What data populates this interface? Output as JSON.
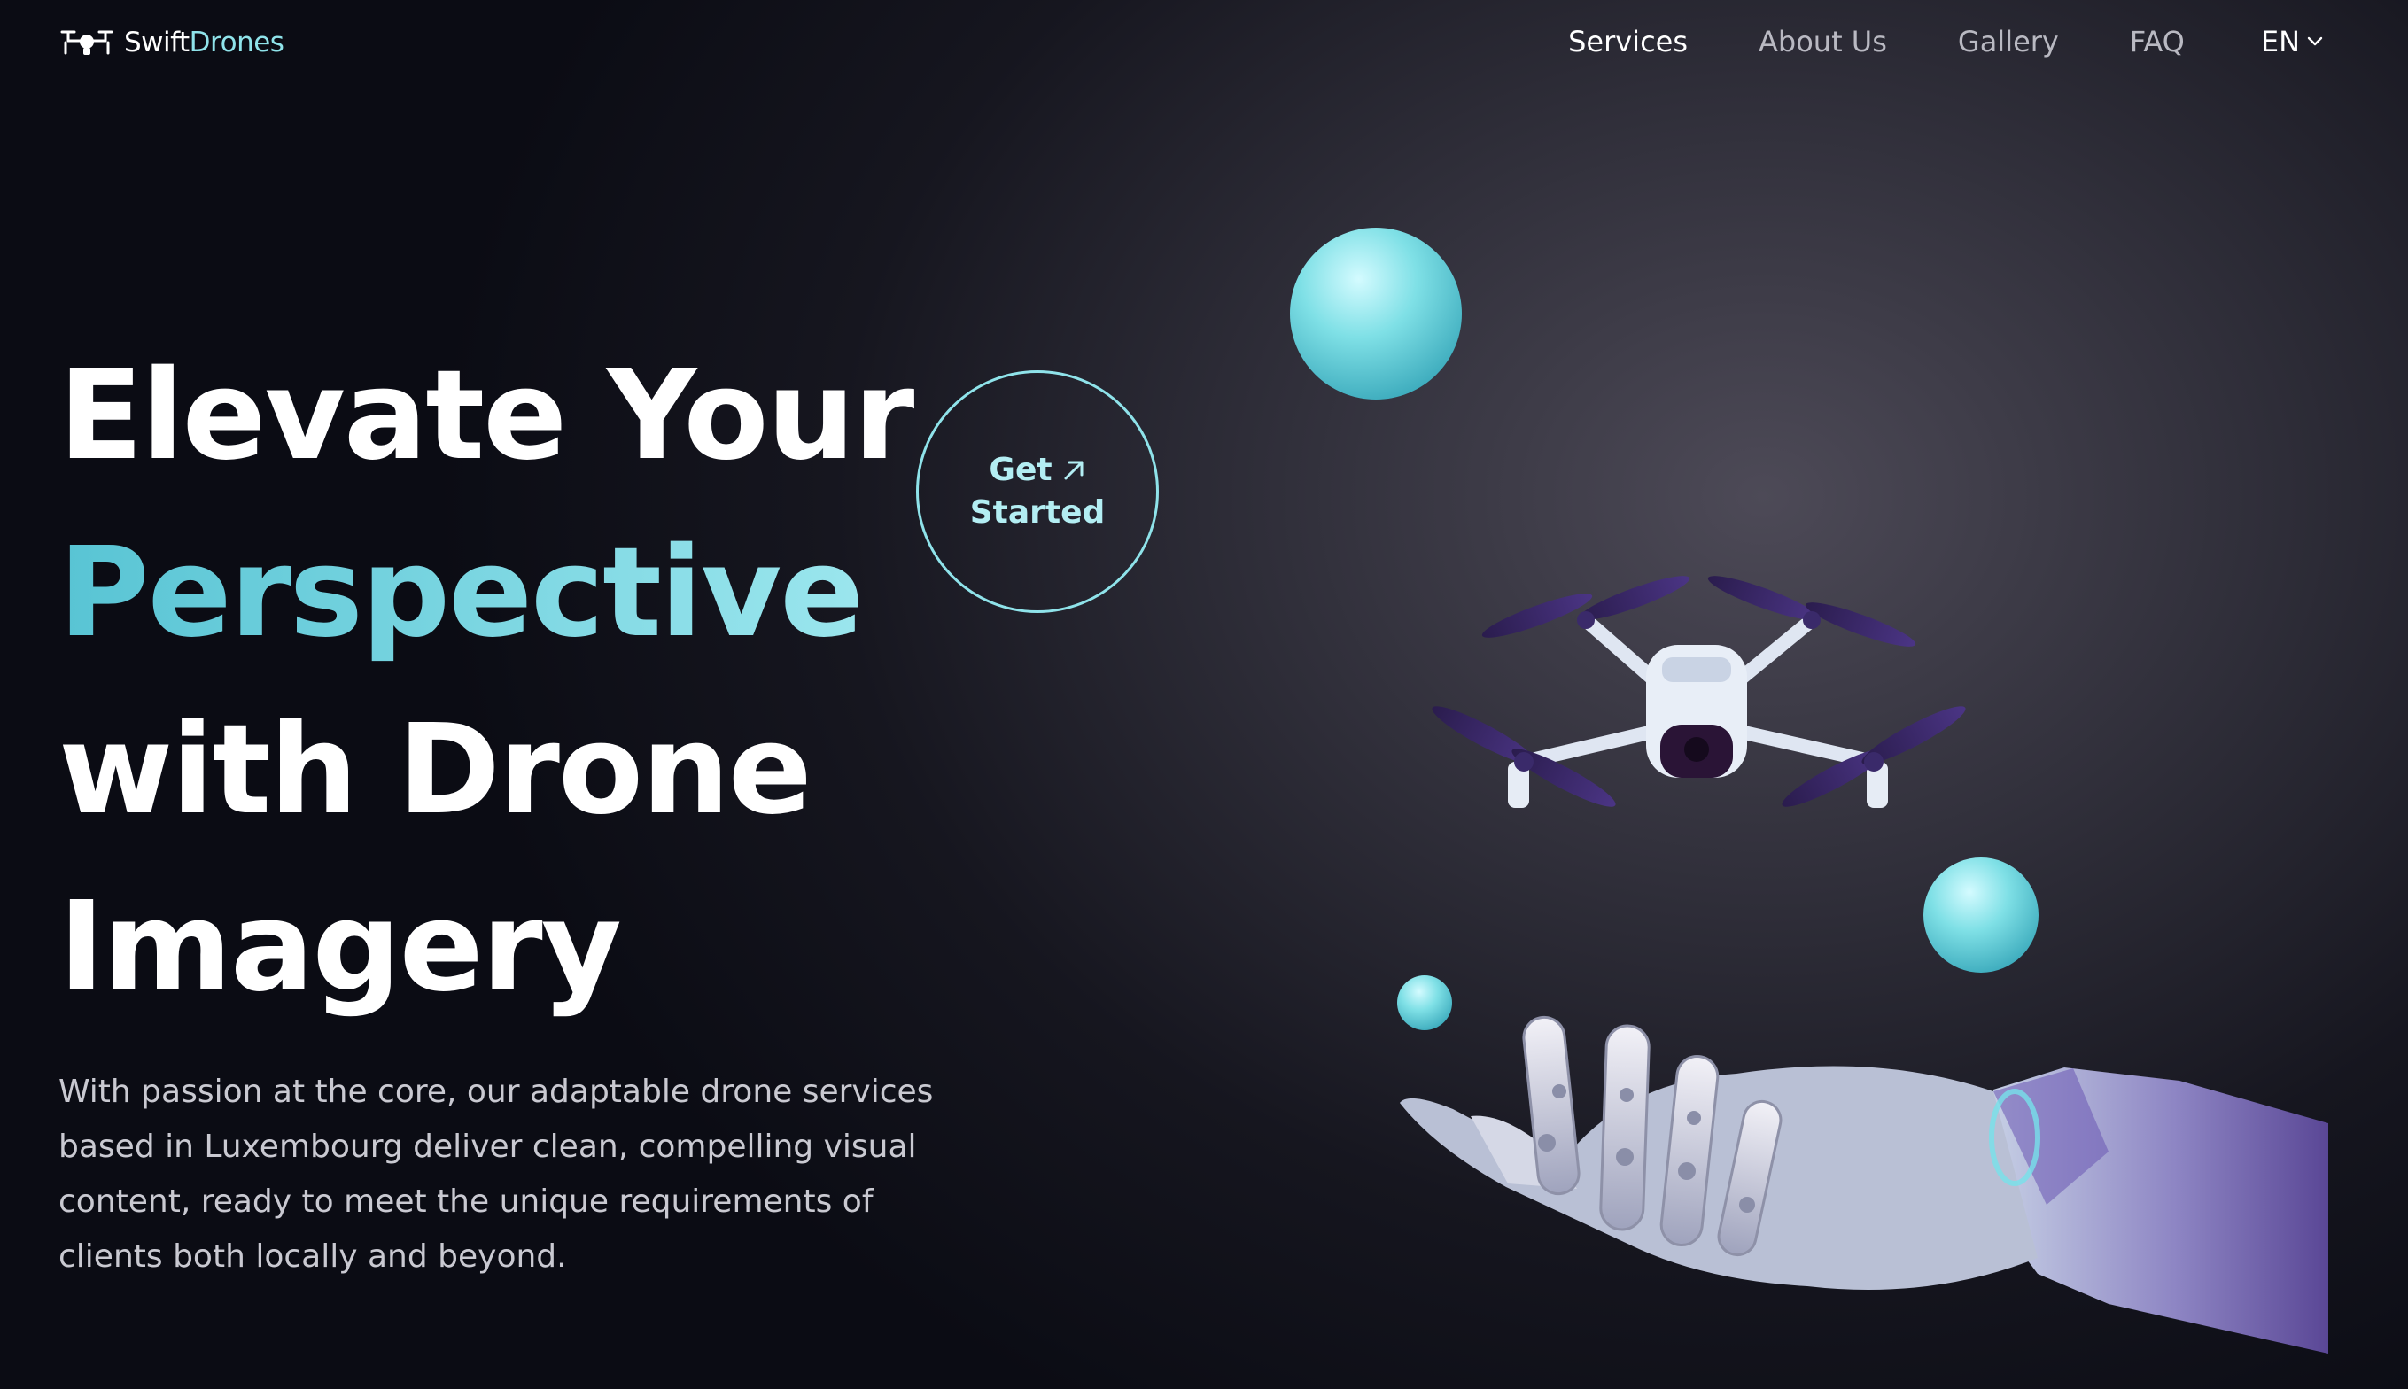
{
  "brand": {
    "name_part1": "Swift",
    "name_part2": "Drones",
    "icon": "drone-logo-icon"
  },
  "nav": {
    "links": [
      {
        "label": "Services",
        "active": true
      },
      {
        "label": "About Us",
        "active": false
      },
      {
        "label": "Gallery",
        "active": false
      },
      {
        "label": "FAQ",
        "active": false
      }
    ],
    "language": {
      "label": "EN",
      "icon": "chevron-down-icon"
    }
  },
  "hero": {
    "headline": {
      "line1": "Elevate Your",
      "line2": "Perspective",
      "line3": "with Drone",
      "line4": "Imagery"
    },
    "description": "With passion at the core, our adaptable drone services based in Luxembourg deliver clean, compelling visual content, ready to meet the unique requirements of clients both locally and beyond.",
    "cta": {
      "line1": "Get",
      "line2": "Started",
      "icon": "arrow-up-right-icon"
    }
  },
  "illustration": {
    "icons": [
      "drone-icon",
      "robot-hand-icon",
      "sphere-icon"
    ]
  },
  "colors": {
    "accent": "#8fe3ea",
    "accent_dark": "#58c4d4",
    "background": "#0b0c14",
    "text": "#ffffff",
    "muted": "#c9c9d1"
  }
}
